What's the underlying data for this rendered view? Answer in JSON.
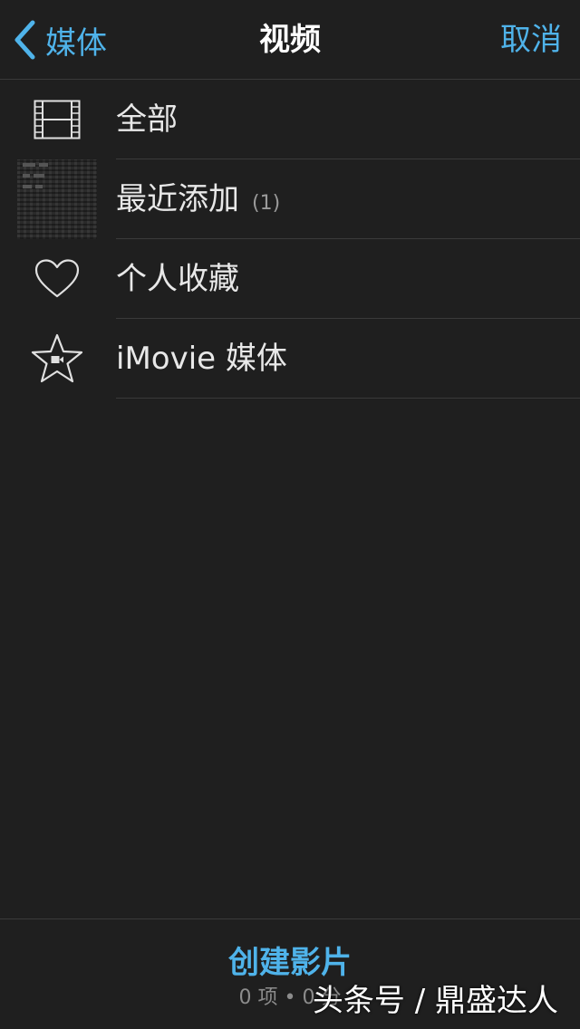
{
  "nav": {
    "back_label": "媒体",
    "title": "视频",
    "cancel_label": "取消"
  },
  "list": {
    "items": [
      {
        "label": "全部",
        "count": "",
        "icon": "film-strip-icon"
      },
      {
        "label": "最近添加",
        "count": "(1)",
        "icon": "recent-thumbnail"
      },
      {
        "label": "个人收藏",
        "count": "",
        "icon": "heart-icon"
      },
      {
        "label": "iMovie 媒体",
        "count": "",
        "icon": "imovie-star-icon"
      }
    ]
  },
  "toolbar": {
    "create_label": "创建影片",
    "summary": "0 项 • 0 分"
  },
  "watermark": "头条号 / 鼎盛达人",
  "colors": {
    "accent": "#4fb3ea",
    "background": "#1f1f1f",
    "text": "#e8e8e8",
    "divider": "#3a3a3a"
  }
}
